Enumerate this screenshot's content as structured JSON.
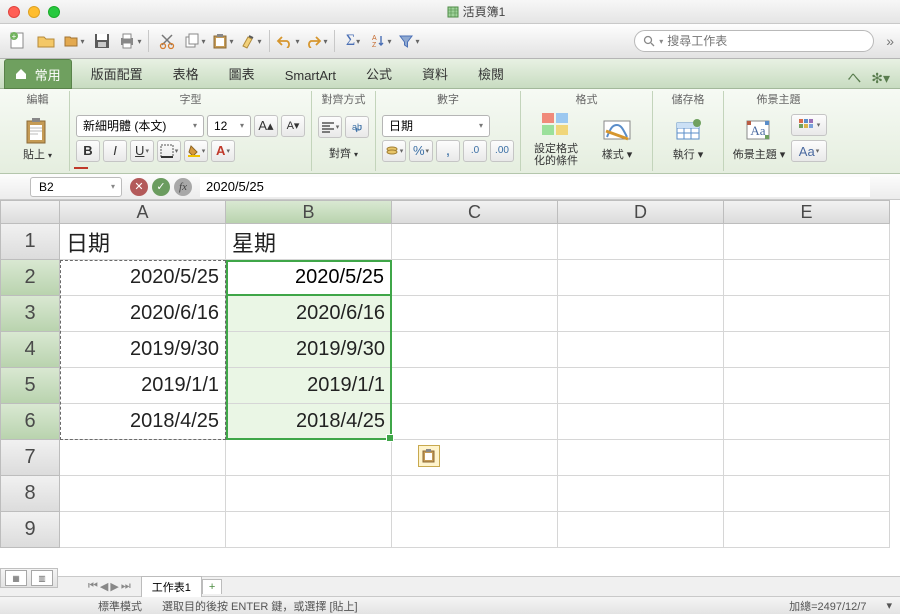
{
  "window": {
    "title": "活頁簿1"
  },
  "search": {
    "placeholder": "搜尋工作表"
  },
  "tabs": {
    "home": "常用",
    "items": [
      "版面配置",
      "表格",
      "圖表",
      "SmartArt",
      "公式",
      "資料",
      "檢閱"
    ]
  },
  "ribbon": {
    "edit_label": "編輯",
    "paste_label": "貼上",
    "font_label": "字型",
    "font_name": "新細明體 (本文)",
    "font_size": "12",
    "align_group": "對齊方式",
    "align_label": "對齊",
    "number_group": "數字",
    "number_format": "日期",
    "format_group": "格式",
    "cond_format_label": "設定格式化的條件",
    "styles_label": "樣式",
    "cells_group": "儲存格",
    "cells_label": "執行",
    "themes_group": "佈景主題",
    "themes_label": "佈景主題",
    "themes_aa": "Aa"
  },
  "formula_bar": {
    "name": "B2",
    "formula": "2020/5/25"
  },
  "columns": [
    "A",
    "B",
    "C",
    "D",
    "E"
  ],
  "headers": {
    "A": "日期",
    "B": "星期"
  },
  "rows": [
    {
      "A": "2020/5/25",
      "B": "2020/5/25"
    },
    {
      "A": "2020/6/16",
      "B": "2020/6/16"
    },
    {
      "A": "2019/9/30",
      "B": "2019/9/30"
    },
    {
      "A": "2019/1/1",
      "B": "2019/1/1"
    },
    {
      "A": "2018/4/25",
      "B": "2018/4/25"
    }
  ],
  "sheet": {
    "tab1": "工作表1"
  },
  "status": {
    "mode": "標準模式",
    "hint": "選取目的後按 ENTER 鍵，或選擇 [貼上]",
    "sum": "加總=2497/12/7"
  }
}
